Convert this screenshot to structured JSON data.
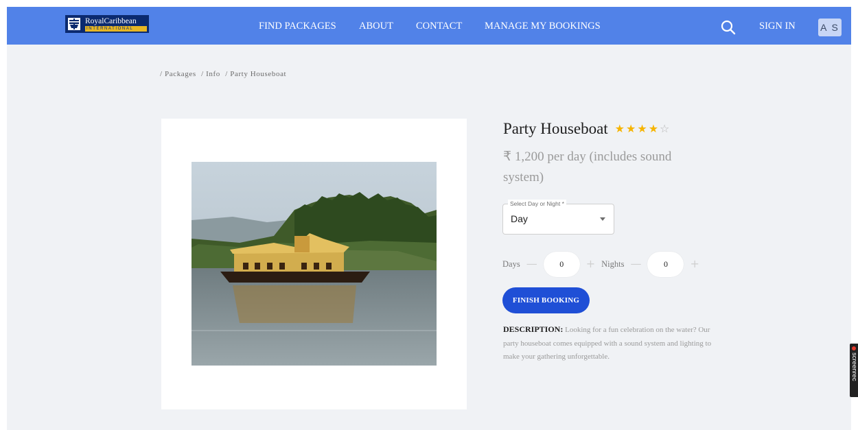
{
  "brand": {
    "name": "RoyalCaribbean",
    "subtitle": "INTERNATIONAL",
    "colors": {
      "nav_bg": "#5182e8",
      "logo_bg": "#0b2a6f",
      "logo_accent": "#e7b623",
      "button": "#1f4fd6",
      "star": "#f6b400"
    }
  },
  "nav": {
    "links": [
      "FIND PACKAGES",
      "ABOUT",
      "CONTACT",
      "MANAGE MY BOOKINGS"
    ],
    "search_icon": "search-icon",
    "sign_in": "SIGN IN",
    "avatar_initials": "A S"
  },
  "breadcrumb": [
    "/ Packages",
    "/ Info",
    "/ Party Houseboat"
  ],
  "product": {
    "title": "Party Houseboat",
    "rating": 4,
    "rating_max": 5,
    "price": "₹ 1,200 per day (includes sound system)",
    "image": "houseboat-photo"
  },
  "booking": {
    "select_label": "Select Day or Night *",
    "select_value": "Day",
    "days_label": "Days",
    "days_value": "0",
    "nights_label": "Nights",
    "nights_value": "0",
    "minus_symbol": "—",
    "plus_symbol": "+",
    "finish_label": "FINISH BOOKING"
  },
  "description": {
    "label": "DESCRIPTION:",
    "text": "Looking for a fun celebration on the water? Our party houseboat comes equipped with a sound system and lighting to make your gathering unforgettable."
  },
  "recorder": {
    "label": "screenrec"
  }
}
